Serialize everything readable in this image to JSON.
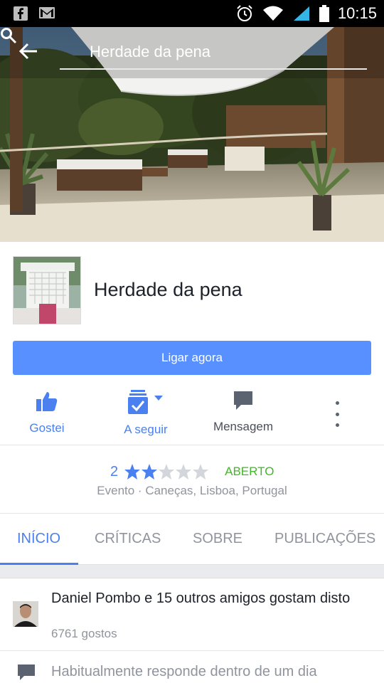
{
  "status_bar": {
    "time": "10:15",
    "left_icons": [
      "facebook-icon",
      "gmail-icon"
    ],
    "right_icons": [
      "alarm-icon",
      "wifi-icon",
      "signal-icon",
      "battery-icon"
    ]
  },
  "search": {
    "query": "Herdade da pena"
  },
  "page": {
    "name": "Herdade da pena",
    "call_button": "Ligar agora"
  },
  "actions": {
    "like": "Gostei",
    "follow": "A seguir",
    "message": "Mensagem"
  },
  "rating": {
    "value": "2",
    "stars_filled": 2,
    "stars_total": 5,
    "status": "ABERTO",
    "category": "Evento · Caneças, Lisboa, Portugal"
  },
  "tabs": [
    "INÍCIO",
    "CRÍTICAS",
    "SOBRE",
    "PUBLICAÇÕES"
  ],
  "about_card": {
    "friends_like": "Daniel Pombo e 15 outros amigos gostam disto",
    "likes_count": "6761 gostos",
    "response_time": "Habitualmente responde dentro de um dia"
  },
  "colors": {
    "accent": "#4a80f0",
    "call_button": "#5890ff",
    "open_green": "#42b72a"
  }
}
